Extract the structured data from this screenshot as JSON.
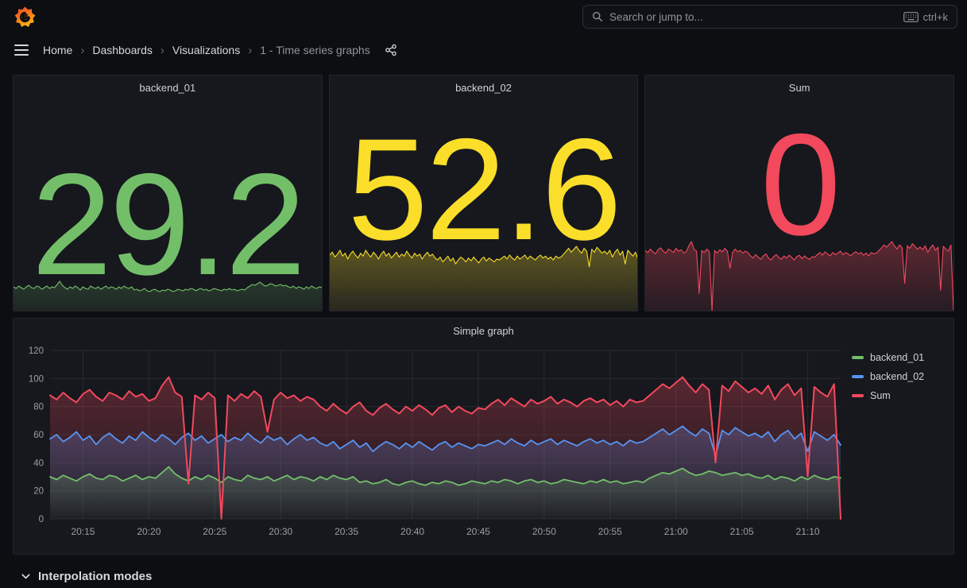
{
  "topbar": {
    "search_placeholder": "Search or jump to...",
    "shortcut_label": "ctrl+k"
  },
  "breadcrumb": {
    "items": [
      "Home",
      "Dashboards",
      "Visualizations",
      "1 - Time series graphs"
    ]
  },
  "icons": {
    "logo": "grafana-flame-spiral",
    "search": "magnifier",
    "keyboard": "keyboard",
    "menu": "hamburger-menu",
    "share": "share-nodes",
    "breadcrumb_separator": "›",
    "row_chevron": "chevron-down",
    "legend_dash": "series-color-dash"
  },
  "colors": {
    "page_bg": "#0d0e12",
    "panel_bg": "#16181e",
    "panel_border": "#23252c",
    "text_primary": "#d7d8dc",
    "text_secondary": "#8e929a",
    "grid": "rgba(150,170,150,0.12)",
    "green": "#73BF69",
    "yellow": "#FADE2A",
    "blue": "#5794F2",
    "red": "#F2495C"
  },
  "stat_panels": [
    {
      "title": "backend_01",
      "value": "29.2",
      "color": "#73BF69",
      "series": "backend_01"
    },
    {
      "title": "backend_02",
      "value": "52.6",
      "color": "#FADE2A",
      "series": "backend_02"
    },
    {
      "title": "Sum",
      "value": "0",
      "color": "#F2495C",
      "series": "Sum"
    }
  ],
  "graph_panel": {
    "title": "Simple graph"
  },
  "chart_data": {
    "type": "line",
    "title": "Simple graph",
    "x_unit": "time",
    "x_range_min": 0,
    "x_range_max": 60,
    "x_ticks": [
      {
        "label": "20:15",
        "t": 2.5
      },
      {
        "label": "20:20",
        "t": 7.5
      },
      {
        "label": "20:25",
        "t": 12.5
      },
      {
        "label": "20:30",
        "t": 17.5
      },
      {
        "label": "20:35",
        "t": 22.5
      },
      {
        "label": "20:40",
        "t": 27.5
      },
      {
        "label": "20:45",
        "t": 32.5
      },
      {
        "label": "20:50",
        "t": 37.5
      },
      {
        "label": "20:55",
        "t": 42.5
      },
      {
        "label": "21:00",
        "t": 47.5
      },
      {
        "label": "21:05",
        "t": 52.5
      },
      {
        "label": "21:10",
        "t": 57.5
      }
    ],
    "ylim": [
      0,
      120
    ],
    "y_ticks": [
      0,
      20,
      40,
      60,
      80,
      100,
      120
    ],
    "grid": true,
    "legend_position": "right",
    "fill_gradient": "opacity",
    "series": [
      {
        "name": "backend_01",
        "color": "#73BF69",
        "values": [
          30,
          28,
          31,
          29,
          27,
          30,
          32,
          29,
          28,
          31,
          30,
          27,
          29,
          31,
          28,
          30,
          29,
          33,
          37,
          32,
          29,
          27,
          30,
          28,
          31,
          29,
          26,
          30,
          28,
          27,
          31,
          29,
          28,
          30,
          27,
          29,
          31,
          28,
          30,
          29,
          27,
          30,
          28,
          31,
          29,
          28,
          30,
          26,
          27,
          25,
          26,
          28,
          25,
          24,
          26,
          27,
          25,
          24,
          26,
          25,
          27,
          26,
          24,
          25,
          27,
          26,
          25,
          27,
          26,
          28,
          27,
          25,
          27,
          28,
          26,
          27,
          25,
          26,
          28,
          27,
          26,
          25,
          27,
          26,
          28,
          26,
          27,
          25,
          26,
          27,
          26,
          29,
          31,
          33,
          32,
          34,
          36,
          33,
          31,
          32,
          34,
          33,
          31,
          32,
          33,
          31,
          32,
          30,
          29,
          31,
          28,
          30,
          29,
          27,
          30,
          28,
          31,
          29,
          28,
          30,
          29.2
        ]
      },
      {
        "name": "backend_02",
        "color": "#5794F2",
        "values": [
          57,
          60,
          55,
          58,
          62,
          56,
          59,
          53,
          58,
          61,
          57,
          54,
          59,
          56,
          62,
          58,
          55,
          60,
          57,
          53,
          58,
          61,
          56,
          59,
          54,
          57,
          60,
          55,
          58,
          56,
          61,
          57,
          54,
          59,
          56,
          58,
          53,
          57,
          60,
          56,
          58,
          54,
          52,
          55,
          50,
          53,
          56,
          51,
          54,
          48,
          52,
          55,
          53,
          50,
          54,
          51,
          55,
          52,
          49,
          53,
          55,
          51,
          54,
          52,
          50,
          53,
          52,
          54,
          56,
          53,
          57,
          54,
          52,
          56,
          53,
          55,
          57,
          53,
          56,
          54,
          52,
          55,
          57,
          54,
          56,
          53,
          55,
          52,
          56,
          54,
          55,
          58,
          61,
          64,
          60,
          63,
          66,
          62,
          59,
          64,
          61,
          45,
          63,
          60,
          65,
          62,
          59,
          61,
          58,
          62,
          55,
          60,
          63,
          57,
          61,
          48,
          62,
          59,
          56,
          60,
          52.6
        ]
      },
      {
        "name": "Sum",
        "color": "#F2495C",
        "values": [
          88,
          85,
          90,
          86,
          83,
          89,
          92,
          87,
          84,
          90,
          88,
          85,
          91,
          87,
          89,
          84,
          86,
          95,
          101,
          90,
          87,
          25,
          88,
          85,
          90,
          86,
          0,
          88,
          84,
          89,
          86,
          91,
          87,
          62,
          85,
          90,
          86,
          88,
          84,
          87,
          85,
          80,
          77,
          82,
          78,
          75,
          80,
          83,
          77,
          74,
          79,
          82,
          78,
          75,
          80,
          77,
          81,
          78,
          74,
          79,
          81,
          76,
          80,
          77,
          75,
          79,
          78,
          82,
          85,
          81,
          86,
          83,
          80,
          85,
          82,
          84,
          87,
          82,
          85,
          83,
          80,
          84,
          86,
          83,
          85,
          81,
          84,
          80,
          85,
          83,
          84,
          88,
          92,
          96,
          93,
          97,
          101,
          95,
          90,
          96,
          92,
          40,
          95,
          91,
          98,
          94,
          90,
          93,
          89,
          95,
          85,
          92,
          96,
          88,
          93,
          30,
          94,
          90,
          87,
          96,
          0
        ]
      }
    ]
  },
  "row_footer": {
    "label": "Interpolation modes"
  }
}
